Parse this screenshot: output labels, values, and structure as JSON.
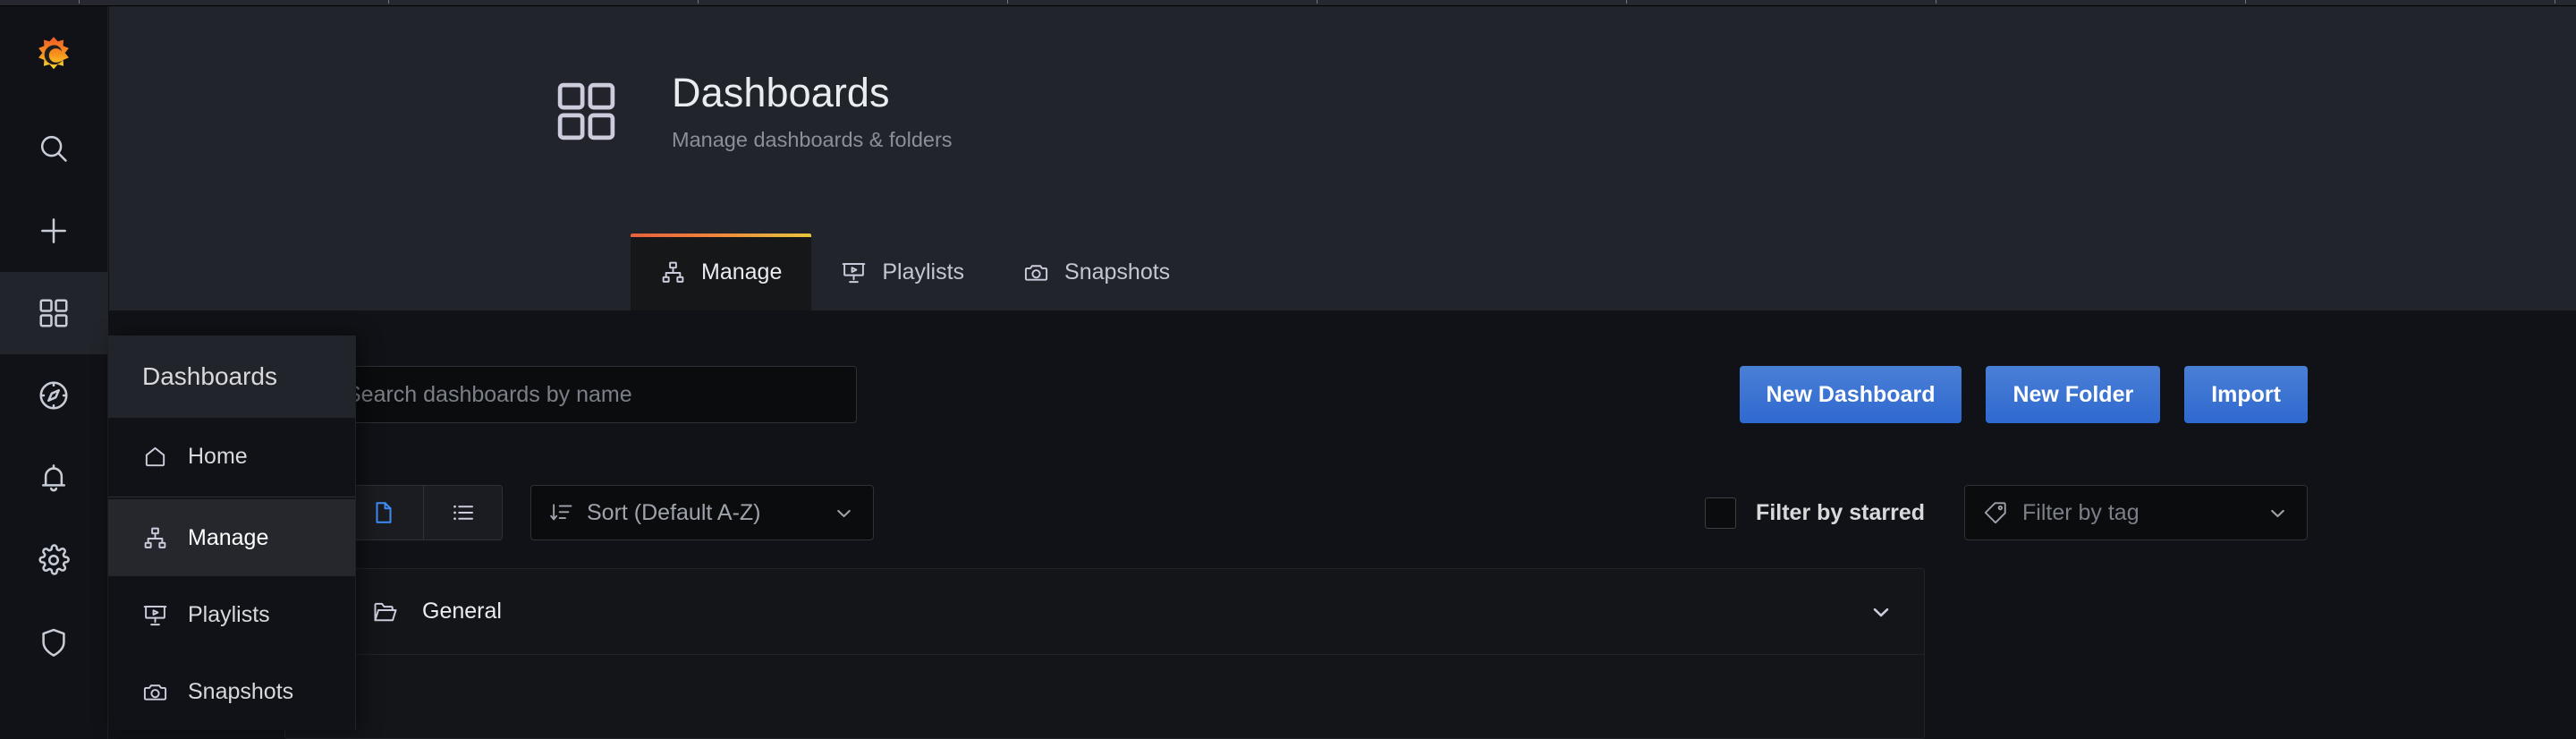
{
  "app": {
    "brand_icon": "grafana-logo",
    "accent_blue": "#3871dc",
    "accent_gradient_from": "#e8603c",
    "accent_gradient_to": "#e5c63c"
  },
  "sidebar": {
    "items": [
      {
        "icon": "search-icon",
        "name": "search"
      },
      {
        "icon": "plus-icon",
        "name": "create"
      },
      {
        "icon": "apps-grid-icon",
        "name": "dashboards",
        "active": true
      },
      {
        "icon": "compass-icon",
        "name": "explore"
      },
      {
        "icon": "bell-icon",
        "name": "alerting"
      },
      {
        "icon": "gear-icon",
        "name": "configuration"
      },
      {
        "icon": "shield-icon",
        "name": "server-admin"
      }
    ]
  },
  "flyout": {
    "title": "Dashboards",
    "items": [
      {
        "label": "Home",
        "icon": "home-icon",
        "active": false
      },
      {
        "label": "Manage",
        "icon": "sitemap-icon",
        "active": true
      },
      {
        "label": "Playlists",
        "icon": "presentation-icon",
        "active": false
      },
      {
        "label": "Snapshots",
        "icon": "camera-icon",
        "active": false
      }
    ]
  },
  "header": {
    "icon": "apps-grid-icon",
    "title": "Dashboards",
    "subtitle": "Manage dashboards & folders",
    "tabs": [
      {
        "label": "Manage",
        "icon": "sitemap-icon",
        "active": true
      },
      {
        "label": "Playlists",
        "icon": "presentation-icon",
        "active": false
      },
      {
        "label": "Snapshots",
        "icon": "camera-icon",
        "active": false
      }
    ]
  },
  "search": {
    "placeholder": "Search dashboards by name",
    "value": "",
    "icon": "search-icon"
  },
  "actions": {
    "new_dashboard": "New Dashboard",
    "new_folder": "New Folder",
    "import": "Import"
  },
  "toolbar": {
    "select_all_checked": false,
    "view_folders_icon": "folder-icon",
    "view_list_icon": "list-icon",
    "view_mode": "folders",
    "sort": {
      "label": "Sort (Default A-Z)",
      "icon": "sort-amount-down-icon",
      "chevron": "chevron-down-icon"
    },
    "starred": {
      "label": "Filter by starred",
      "checked": false
    },
    "tag": {
      "placeholder": "Filter by tag",
      "icon": "tag-icon",
      "chevron": "chevron-down-icon"
    }
  },
  "results": {
    "rows": [
      {
        "name": "General",
        "icon": "folder-open-icon",
        "checked": false,
        "chevron": "chevron-down-icon",
        "expanded": true
      }
    ]
  }
}
